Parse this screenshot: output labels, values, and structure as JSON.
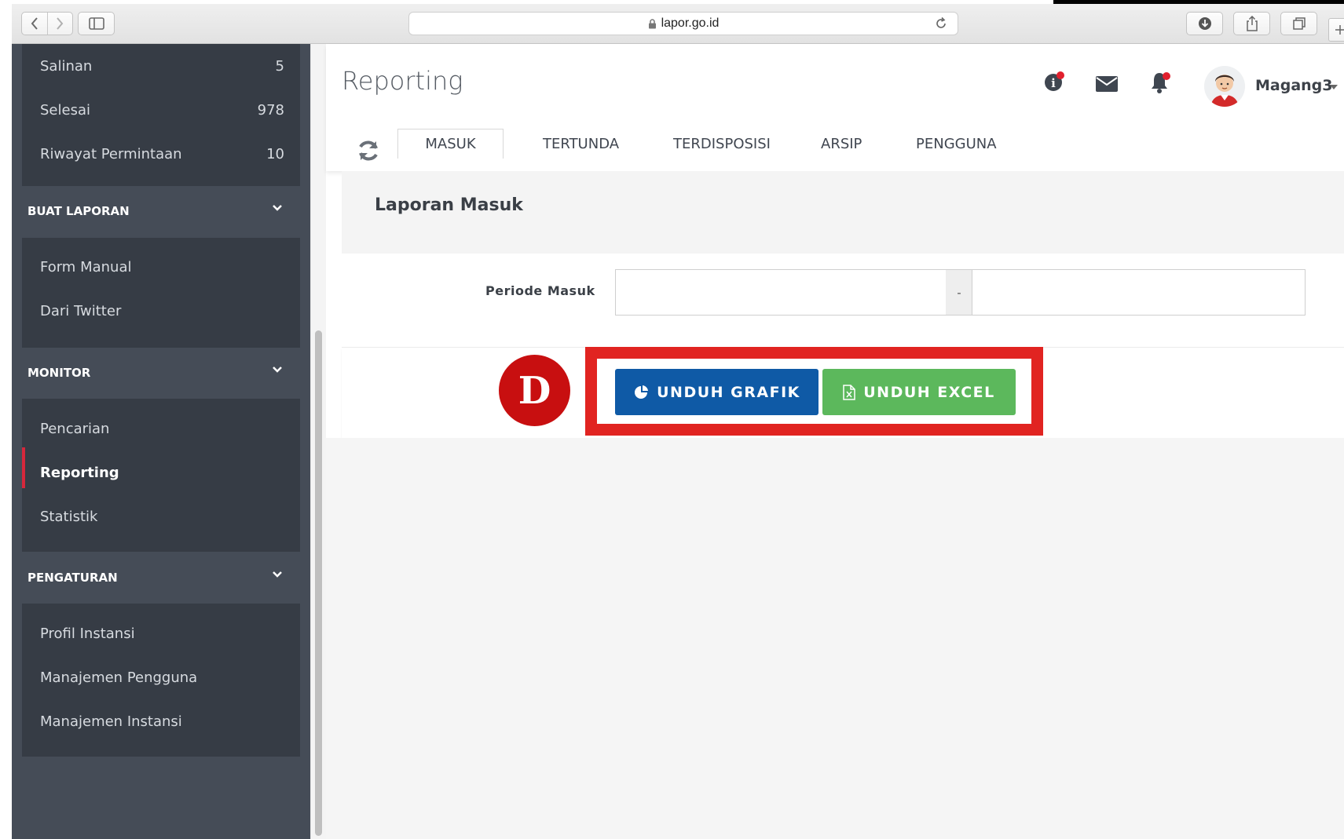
{
  "browser": {
    "url": "lapor.go.id"
  },
  "sidebar": {
    "top_items": [
      {
        "label": "Salinan",
        "count": "5"
      },
      {
        "label": "Selesai",
        "count": "978"
      },
      {
        "label": "Riwayat Permintaan",
        "count": "10"
      }
    ],
    "sections": [
      {
        "title": "BUAT LAPORAN",
        "items": [
          "Form Manual",
          "Dari Twitter"
        ]
      },
      {
        "title": "MONITOR",
        "items": [
          "Pencarian",
          "Reporting",
          "Statistik"
        ]
      },
      {
        "title": "PENGATURAN",
        "items": [
          "Profil Instansi",
          "Manajemen Pengguna",
          "Manajemen Instansi"
        ]
      }
    ],
    "active_item": "Reporting"
  },
  "header": {
    "title": "Reporting",
    "username": "Magang3"
  },
  "tabs": [
    "MASUK",
    "TERTUNDA",
    "TERDISPOSISI",
    "ARSIP",
    "PENGGUNA"
  ],
  "active_tab": "MASUK",
  "content": {
    "title": "Laporan Masuk",
    "period_label": "Periode Masuk",
    "period_separator": "-",
    "period_start": "",
    "period_end": ""
  },
  "buttons": {
    "grafik": "UNDUH GRAFIK",
    "excel": "UNDUH EXCEL"
  },
  "annotation": {
    "marker": "D"
  },
  "colors": {
    "sidebar_bg": "#454c57",
    "accent_red": "#e12421",
    "button_blue": "#0f5aa6",
    "button_green": "#5cb85c"
  }
}
